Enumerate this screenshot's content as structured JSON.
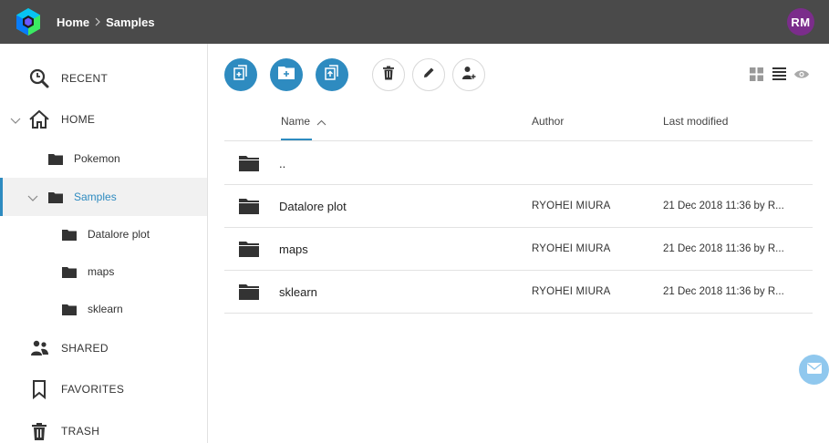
{
  "header": {
    "breadcrumb": [
      "Home",
      "Samples"
    ],
    "avatar_initials": "RM",
    "background_color": "#4a4a4a",
    "avatar_color": "#7b2d8b"
  },
  "sidebar": {
    "recent": "RECENT",
    "home": "HOME",
    "home_children": [
      "Pokemon",
      "Samples"
    ],
    "samples_children": [
      "Datalore plot",
      "maps",
      "sklearn"
    ],
    "shared": "SHARED",
    "favorites": "FAVORITES",
    "trash": "TRASH",
    "selected": "Samples",
    "accent_color": "#2e8bc0"
  },
  "toolbar": {
    "primary_buttons": [
      "new-file-icon",
      "new-folder-icon",
      "upload-file-icon"
    ],
    "secondary_buttons": [
      "trash-icon",
      "pencil-icon",
      "share-user-icon"
    ],
    "view_controls": [
      "grid-view-icon",
      "list-view-icon",
      "eye-icon"
    ]
  },
  "table": {
    "columns": {
      "name": "Name",
      "author": "Author",
      "modified": "Last modified"
    },
    "sort_indicator": "chevron-up-icon",
    "rows": [
      {
        "name": "..",
        "author": "",
        "modified": ""
      },
      {
        "name": "Datalore plot",
        "author": "RYOHEI MIURA",
        "modified": "21 Dec 2018 11:36 by R..."
      },
      {
        "name": "maps",
        "author": "RYOHEI MIURA",
        "modified": "21 Dec 2018 11:36 by R..."
      },
      {
        "name": "sklearn",
        "author": "RYOHEI MIURA",
        "modified": "21 Dec 2018 11:36 by R..."
      }
    ]
  },
  "floating": {
    "icon": "mail-icon",
    "color": "#90c8ee"
  }
}
